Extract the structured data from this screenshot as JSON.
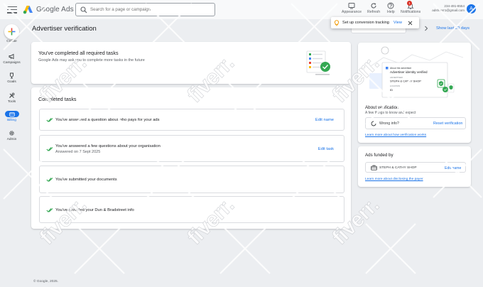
{
  "header": {
    "app_name": "Google Ads",
    "search_placeholder": "Search for a page or campaign",
    "appearance_label": "Appearance",
    "refresh_label": "Refresh",
    "help_label": "Help",
    "notifications_label": "Notifications",
    "notifications_count": "1",
    "account_number": "234-491-8554",
    "account_email": "adsfiverr1@gmail.com",
    "avatar_letter": "A"
  },
  "rail": {
    "create_label": "Create",
    "items": [
      {
        "label": "Campaigns",
        "icon": "megaphone-icon"
      },
      {
        "label": "Goals",
        "icon": "trophy-icon"
      },
      {
        "label": "Tools",
        "icon": "tools-icon"
      },
      {
        "label": "Billing",
        "icon": "credit-card-icon"
      },
      {
        "label": "Admin",
        "icon": "gear-icon"
      }
    ],
    "active": "Billing"
  },
  "page": {
    "title": "Advertiser verification",
    "date_range_link": "Show last 30 days"
  },
  "toast": {
    "text": "Set up conversion tracking",
    "view_label": "View"
  },
  "completed_banner": {
    "title": "You've completed all required tasks",
    "subtitle": "Google Ads may ask you to complete more tasks in the future"
  },
  "completed_tasks": {
    "title": "Completed tasks",
    "items": [
      {
        "label": "You've answered a question about who pays for your ads",
        "date": "",
        "action": "Edit name"
      },
      {
        "label": "You've answered a few questions about your organisation",
        "date": "Answered on 7 Sept 2025",
        "action": "Edit task"
      },
      {
        "label": "You've submitted your documents",
        "date": "",
        "action": ""
      },
      {
        "label": "You've provided your Dun & Bradstreet info",
        "date": "",
        "action": ""
      }
    ]
  },
  "about_verification": {
    "illus_header": "About the advertiser",
    "illus_status": "Advertiser identity verified",
    "illus_advertiser_label": "ADVERTISER",
    "illus_advertiser_name": "STEPH & CATHY SHOP",
    "illus_location_label": "LOCATION",
    "illus_id_label": "ID",
    "title": "About verification",
    "subtitle": "A few things to know and expect",
    "wrong_info_label": "Wrong info?",
    "reset_label": "Reset verification",
    "learn_more": "Learn more about how verification works"
  },
  "ads_funded": {
    "title": "Ads funded by",
    "payer_name": "STEPH & CATHY SHOP",
    "edit_label": "Edit name",
    "learn_more": "Learn more about disclosing the payer"
  },
  "watermark": {
    "text": "fiverr."
  },
  "footer": {
    "copyright": "© Google, 2025."
  },
  "colors": {
    "accent": "#1a73e8",
    "success": "#34a853",
    "badge": "#d93025",
    "background": "#eceef1"
  }
}
